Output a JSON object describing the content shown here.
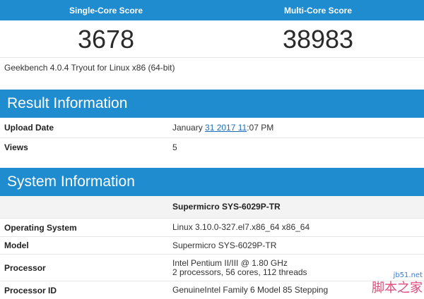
{
  "scores": {
    "single_label": "Single-Core Score",
    "multi_label": "Multi-Core Score",
    "single_value": "3678",
    "multi_value": "38983"
  },
  "version": "Geekbench 4.0.4 Tryout for Linux x86 (64-bit)",
  "result": {
    "title": "Result Information",
    "upload_label": "Upload Date",
    "upload_prefix": "January ",
    "upload_link": "31 2017 11",
    "upload_suffix": ":07 PM",
    "views_label": "Views",
    "views_value": "5"
  },
  "system": {
    "title": "System Information",
    "name": "Supermicro SYS-6029P-TR",
    "os_label": "Operating System",
    "os_value": "Linux 3.10.0-327.el7.x86_64 x86_64",
    "model_label": "Model",
    "model_value": "Supermicro SYS-6029P-TR",
    "proc_label": "Processor",
    "proc_value_1": "Intel Pentium II/III @ 1.80 GHz",
    "proc_value_2": "2 processors, 56 cores, 112 threads",
    "procid_label": "Processor ID",
    "procid_value": "GenuineIntel Family 6 Model 85 Stepping"
  },
  "watermark": {
    "sub": "jb51.net",
    "main": "脚本之家"
  },
  "colors": {
    "accent": "#1f8ccf",
    "link": "#1a6fc0"
  }
}
